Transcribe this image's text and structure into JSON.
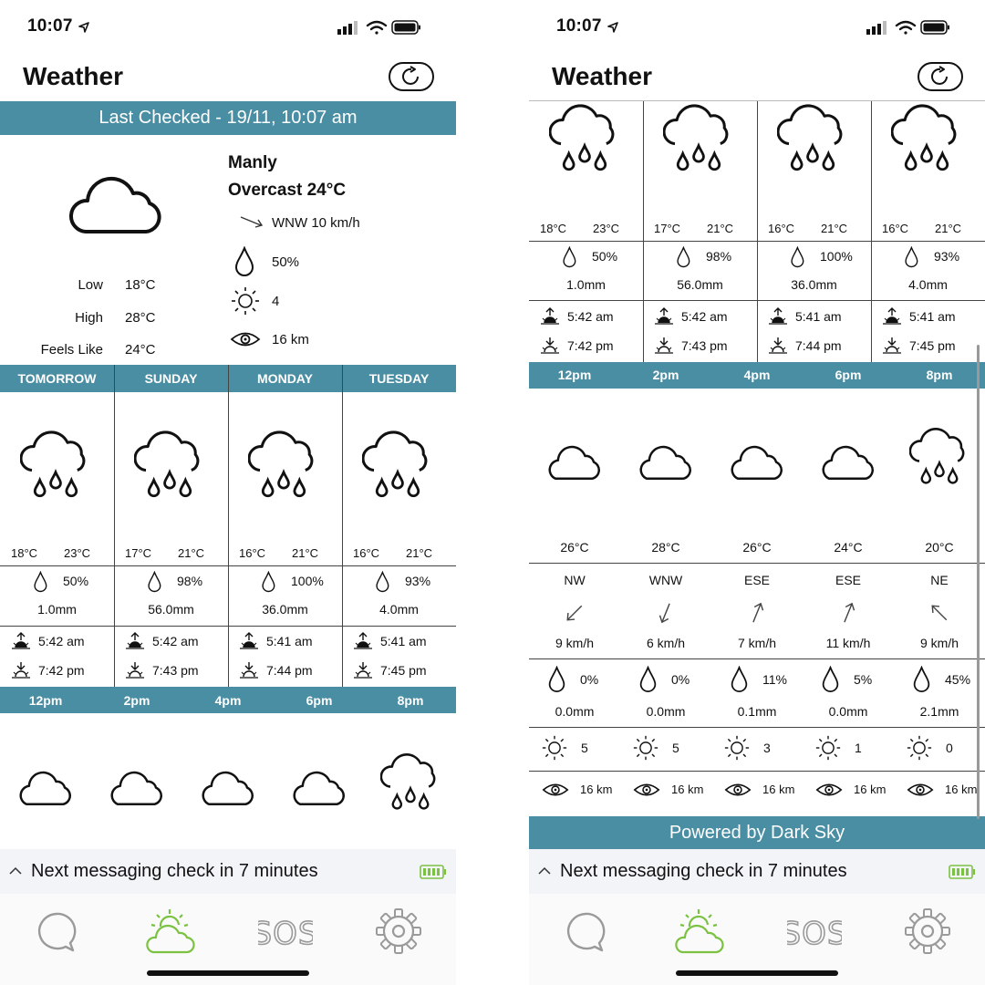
{
  "status": {
    "time": "10:07"
  },
  "header": {
    "title": "Weather"
  },
  "last_checked": "Last Checked - 19/11, 10:07 am",
  "current": {
    "location": "Manly",
    "condition": "Overcast 24°C",
    "wind": "WNW 10 km/h",
    "precip": "50%",
    "uv": "4",
    "visibility": "16 km",
    "low_label": "Low",
    "low": "18°C",
    "high_label": "High",
    "high": "28°C",
    "feels_label": "Feels Like",
    "feels": "24°C"
  },
  "days": [
    {
      "name": "TOMORROW",
      "low": "18°C",
      "high": "23°C",
      "precip": "50%",
      "amount": "1.0mm",
      "sunrise": "5:42 am",
      "sunset": "7:42 pm"
    },
    {
      "name": "SUNDAY",
      "low": "17°C",
      "high": "21°C",
      "precip": "98%",
      "amount": "56.0mm",
      "sunrise": "5:42 am",
      "sunset": "7:43 pm"
    },
    {
      "name": "MONDAY",
      "low": "16°C",
      "high": "21°C",
      "precip": "100%",
      "amount": "36.0mm",
      "sunrise": "5:41 am",
      "sunset": "7:44 pm"
    },
    {
      "name": "TUESDAY",
      "low": "16°C",
      "high": "21°C",
      "precip": "93%",
      "amount": "4.0mm",
      "sunrise": "5:41 am",
      "sunset": "7:45 pm"
    }
  ],
  "hours": [
    {
      "time": "12pm",
      "icon": "cloud-icon",
      "temp": "26°C",
      "wind_dir": "NW",
      "wind_speed": "9 km/h",
      "precip": "0%",
      "amount": "0.0mm",
      "uv": "5",
      "visibility": "16 km"
    },
    {
      "time": "2pm",
      "icon": "cloud-icon",
      "temp": "28°C",
      "wind_dir": "WNW",
      "wind_speed": "6 km/h",
      "precip": "0%",
      "amount": "0.0mm",
      "uv": "5",
      "visibility": "16 km"
    },
    {
      "time": "4pm",
      "icon": "cloud-icon",
      "temp": "26°C",
      "wind_dir": "ESE",
      "wind_speed": "7 km/h",
      "precip": "11%",
      "amount": "0.1mm",
      "uv": "3",
      "visibility": "16 km"
    },
    {
      "time": "6pm",
      "icon": "cloud-icon",
      "temp": "24°C",
      "wind_dir": "ESE",
      "wind_speed": "11 km/h",
      "precip": "5%",
      "amount": "0.0mm",
      "uv": "1",
      "visibility": "16 km"
    },
    {
      "time": "8pm",
      "icon": "rain-cloud-icon",
      "temp": "20°C",
      "wind_dir": "NE",
      "wind_speed": "9 km/h",
      "precip": "45%",
      "amount": "2.1mm",
      "uv": "0",
      "visibility": "16 km"
    }
  ],
  "powered_by": "Powered by Dark Sky",
  "messaging": "Next messaging check in 7 minutes",
  "tabs": [
    {
      "name": "chat-icon",
      "color": "#9a9a9a"
    },
    {
      "name": "weather-icon",
      "color": "#7cc242",
      "active": true
    },
    {
      "name": "sos-icon",
      "label": "SOS",
      "color": "#9a9a9a"
    },
    {
      "name": "gear-icon",
      "color": "#9a9a9a"
    }
  ],
  "colors": {
    "band": "#4a8ea4",
    "battery": "#7cc242",
    "inactive_tab": "#9a9a9a"
  }
}
